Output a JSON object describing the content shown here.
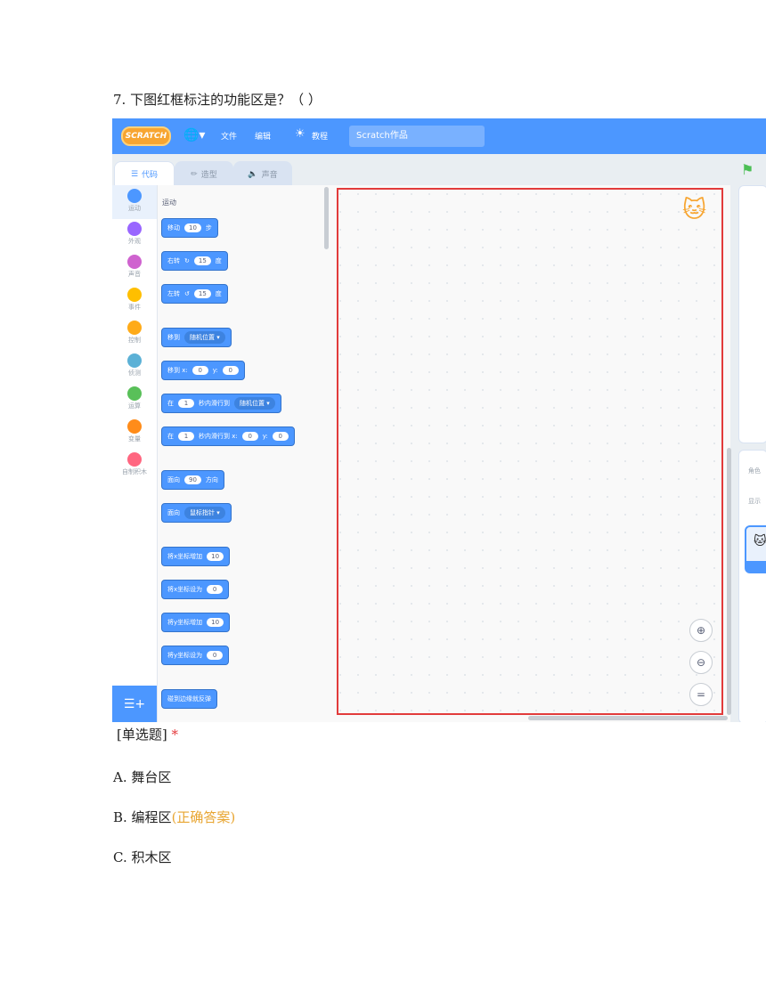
{
  "question": {
    "title": "7. 下图红框标注的功能区是？（ ）",
    "type_label": "[单选题]",
    "required_mark": "*",
    "options": [
      {
        "label": "A. 舞台区",
        "note": ""
      },
      {
        "label": "B. 编程区",
        "note": "(正确答案)"
      },
      {
        "label": "C. 积木区",
        "note": ""
      }
    ]
  },
  "screenshot": {
    "menubar": {
      "logo": "SCRATCH",
      "file": "文件",
      "edit": "编辑",
      "tutorials": "教程",
      "project_title": "Scratch作品"
    },
    "tabs": [
      {
        "label": "代码",
        "icon": "code-icon"
      },
      {
        "label": "造型",
        "icon": "brush-icon"
      },
      {
        "label": "声音",
        "icon": "speaker-icon"
      }
    ],
    "categories": [
      {
        "label": "运动",
        "color": "#4c97ff"
      },
      {
        "label": "外观",
        "color": "#9966ff"
      },
      {
        "label": "声音",
        "color": "#cf63cf"
      },
      {
        "label": "事件",
        "color": "#ffbf00"
      },
      {
        "label": "控制",
        "color": "#ffab19"
      },
      {
        "label": "侦测",
        "color": "#5cb1d6"
      },
      {
        "label": "运算",
        "color": "#59c059"
      },
      {
        "label": "变量",
        "color": "#ff8c1a"
      },
      {
        "label": "自制积木",
        "color": "#ff6680"
      }
    ],
    "palette_title": "运动",
    "blocks": {
      "move": {
        "pre": "移动",
        "val": "10",
        "post": "步"
      },
      "turn_right": {
        "pre": "右转",
        "val": "15",
        "post": "度"
      },
      "turn_left": {
        "pre": "左转",
        "val": "15",
        "post": "度"
      },
      "goto": {
        "pre": "移到",
        "drop": "随机位置"
      },
      "goto_xy": {
        "pre": "移到 x:",
        "x": "0",
        "ylabel": "y:",
        "y": "0"
      },
      "glide": {
        "pre": "在",
        "val": "1",
        "mid": "秒内滑行到",
        "drop": "随机位置"
      },
      "glide_xy": {
        "pre": "在",
        "val": "1",
        "mid": "秒内滑行到 x:",
        "x": "0",
        "ylabel": "y:",
        "y": "0"
      },
      "point_dir": {
        "pre": "面向",
        "val": "90",
        "post": "方向"
      },
      "point_towards": {
        "pre": "面向",
        "drop": "鼠标指针"
      },
      "change_x": {
        "pre": "将x坐标增加",
        "val": "10"
      },
      "set_x": {
        "pre": "将x坐标设为",
        "val": "0"
      },
      "change_y": {
        "pre": "将y坐标增加",
        "val": "10"
      },
      "set_y": {
        "pre": "将y坐标设为",
        "val": "0"
      },
      "bounce": {
        "pre": "碰到边缘就反弹"
      }
    },
    "sprite_pane": {
      "sprite_label": "角色",
      "show_label": "显示"
    }
  }
}
